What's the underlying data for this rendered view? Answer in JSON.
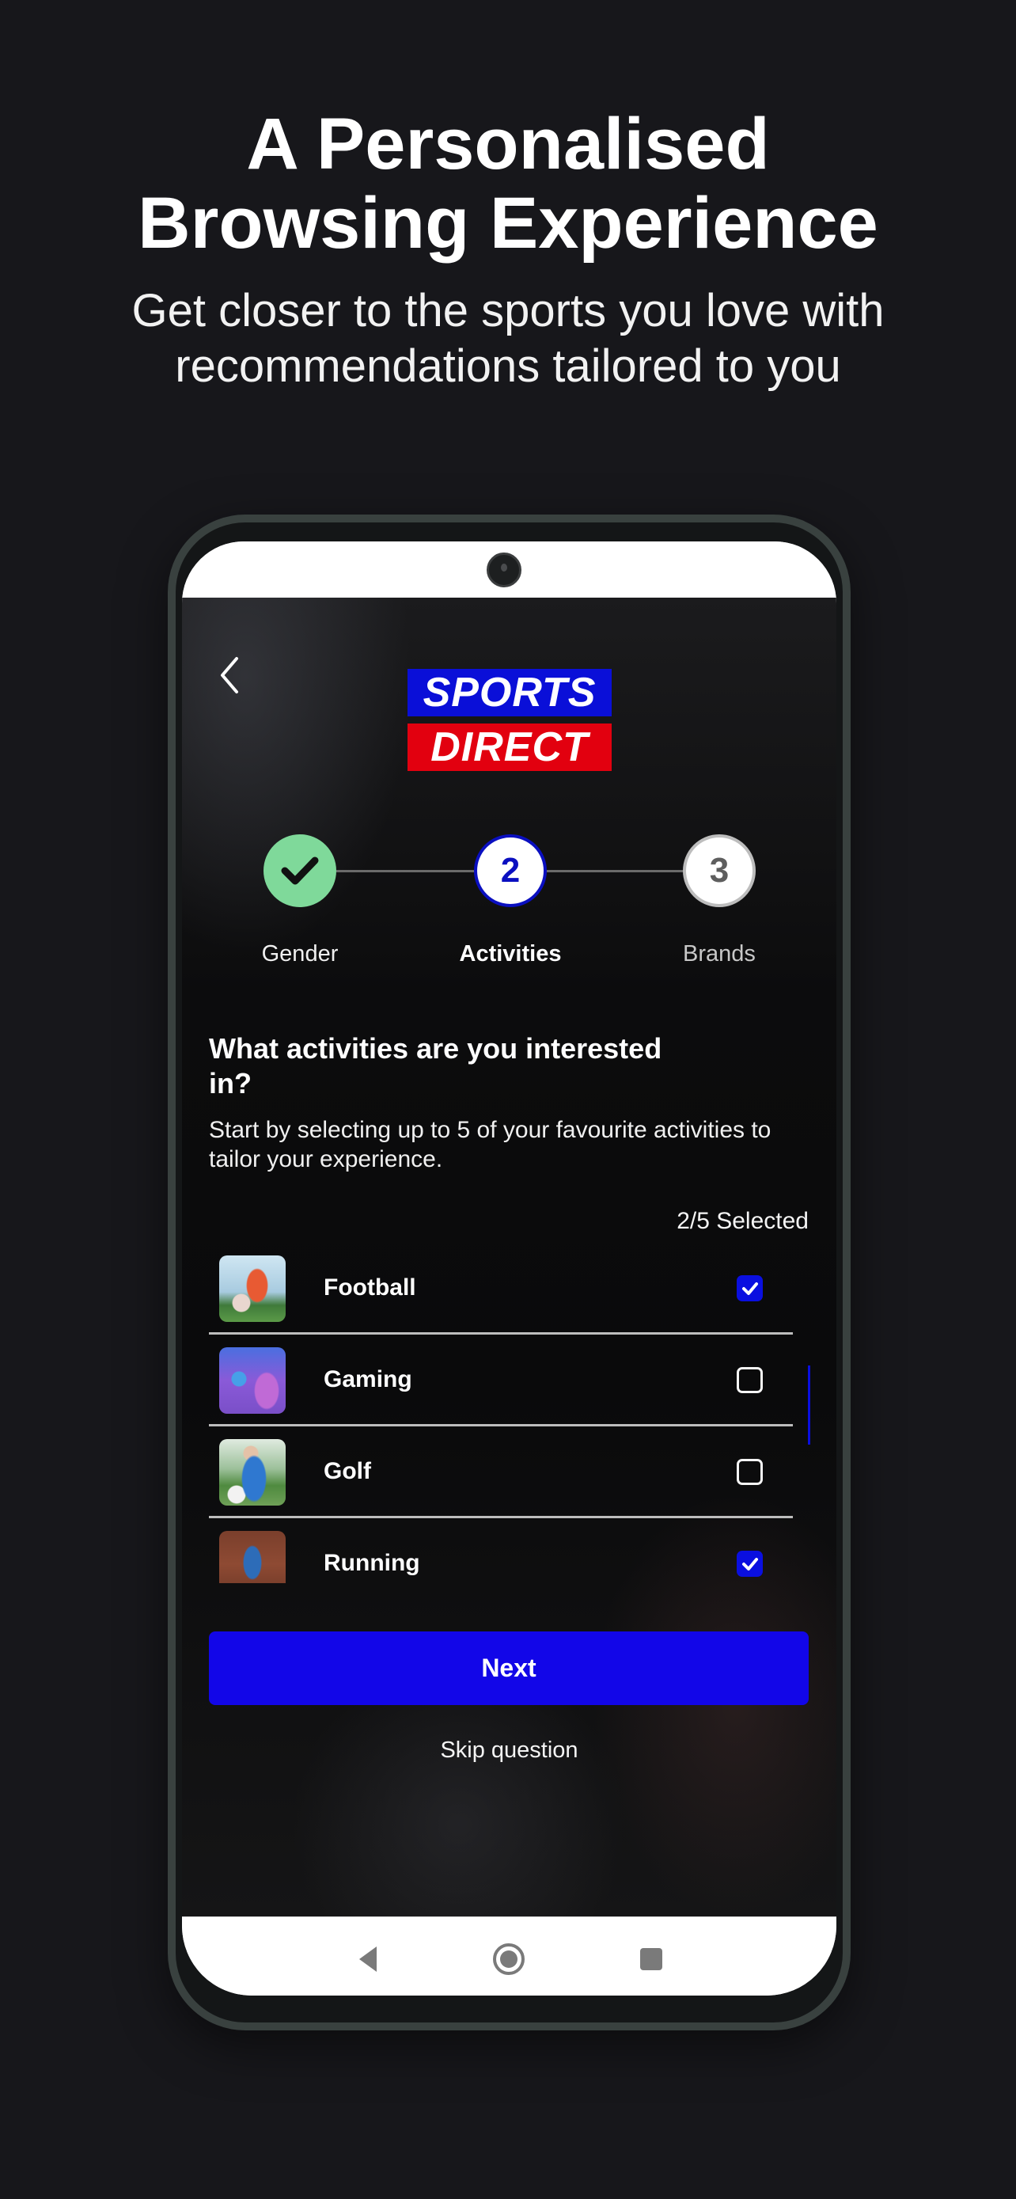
{
  "promo": {
    "headline_line1": "A Personalised",
    "headline_line2": "Browsing Experience",
    "subhead_line1": "Get closer to the sports you love with",
    "subhead_line2": "recommendations tailored to you"
  },
  "app": {
    "brand": {
      "line1": "SPORTS",
      "line2": "DIRECT",
      "colors": {
        "blue": "#0a0fd8",
        "red": "#e2000f"
      }
    },
    "back_icon": "chevron-left-icon",
    "stepper": {
      "steps": [
        {
          "number": "1",
          "label": "Gender",
          "state": "completed",
          "icon": "check-icon"
        },
        {
          "number": "2",
          "label": "Activities",
          "state": "active"
        },
        {
          "number": "3",
          "label": "Brands",
          "state": "pending"
        }
      ],
      "colors": {
        "completed": "#7fd99a",
        "active": "#0a0fc0",
        "pending": "#bdbdbd"
      }
    },
    "question": "What activities are you interested in?",
    "description": "Start by selecting up to 5 of your favourite activities to tailor your experience.",
    "selection_counter": "2/5 Selected",
    "activities": [
      {
        "label": "Football",
        "checked": true
      },
      {
        "label": "Gaming",
        "checked": false
      },
      {
        "label": "Golf",
        "checked": false
      },
      {
        "label": "Running",
        "checked": true
      }
    ],
    "next_button": "Next",
    "skip_link": "Skip question",
    "accent_color": "#1206e8"
  },
  "system_nav": {
    "buttons": [
      "back-triangle-icon",
      "home-circle-icon",
      "recents-square-icon"
    ]
  }
}
